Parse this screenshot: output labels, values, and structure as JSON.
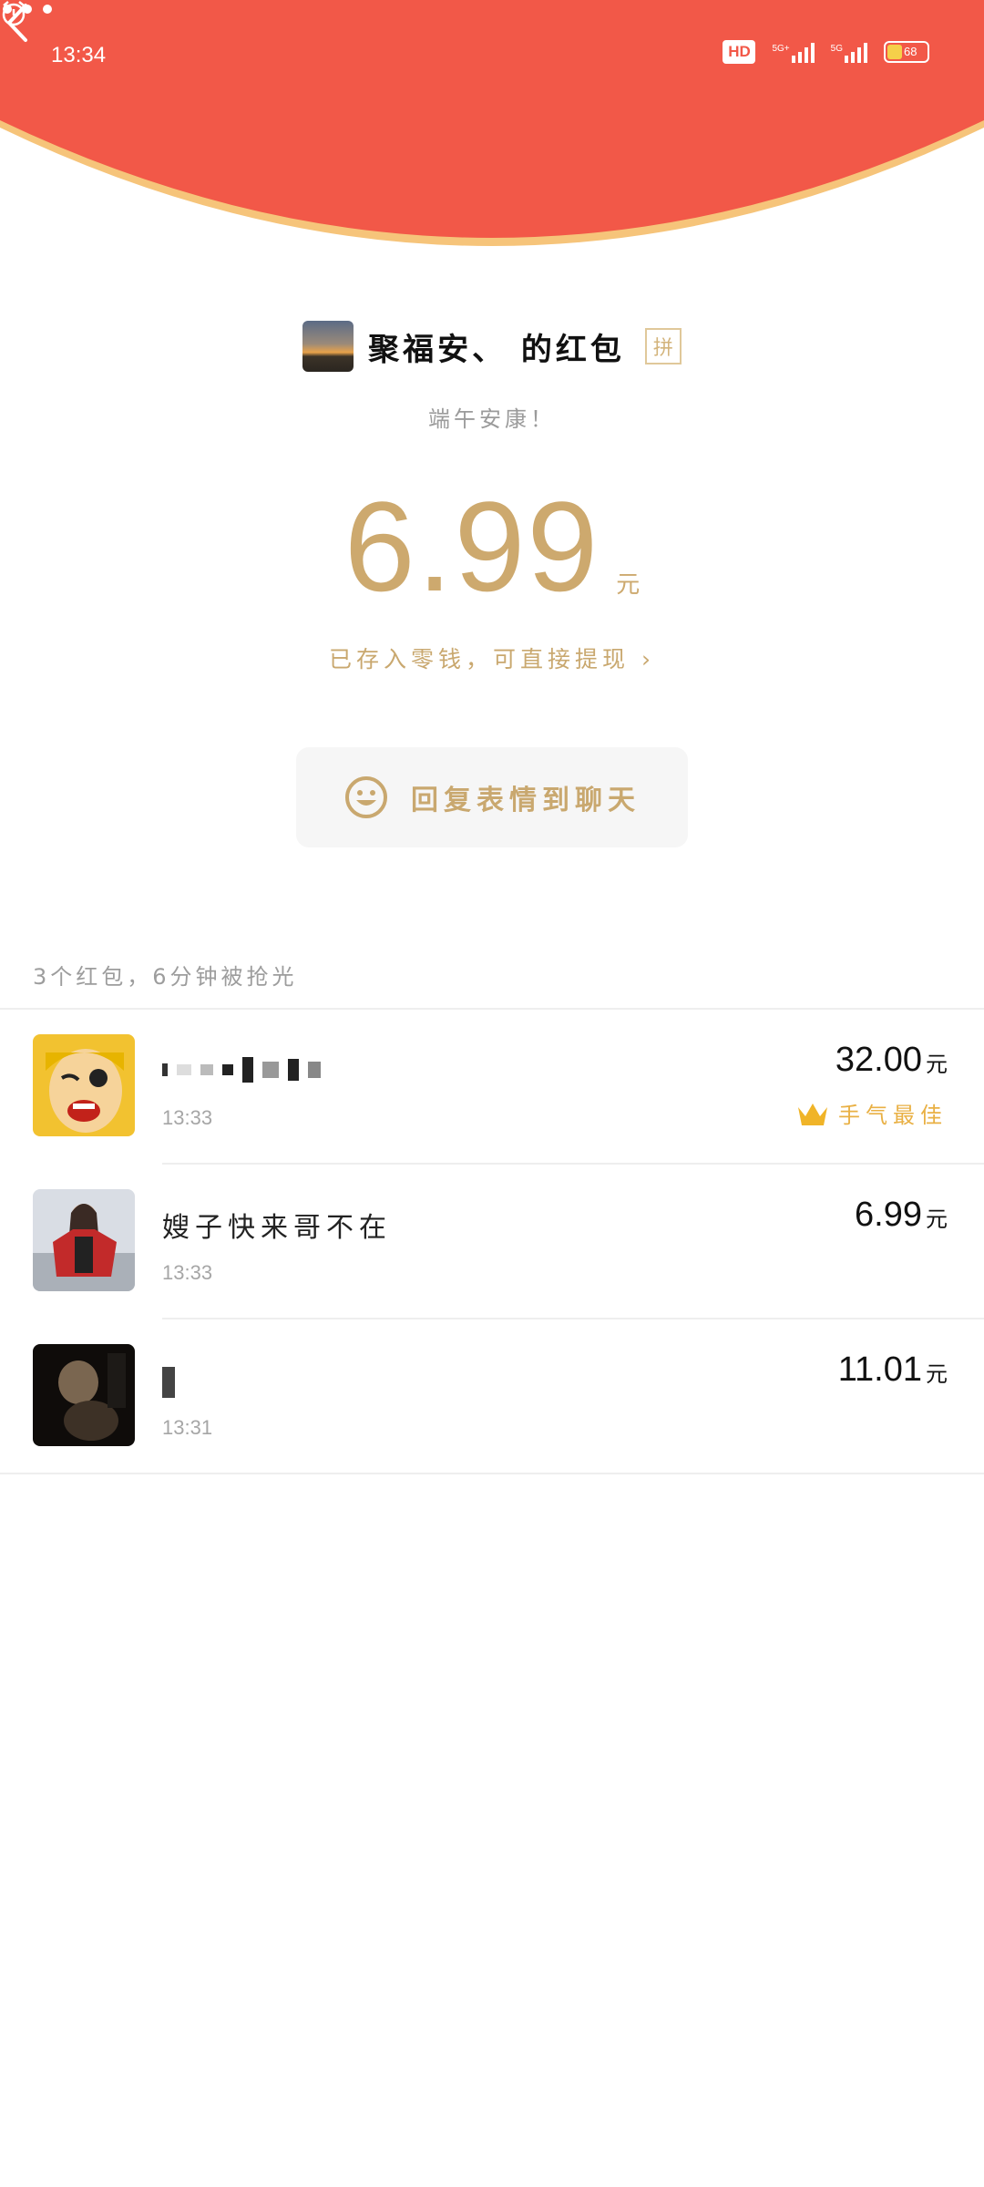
{
  "status_bar": {
    "time": "13:34",
    "hd_label": "HD",
    "sig1_label": "5G+",
    "sig2_label": "5G",
    "battery_level": "68"
  },
  "colors": {
    "header_red": "#f25848",
    "gold": "#cda96e",
    "best_luck": "#e9b044"
  },
  "header": {
    "back_icon": "chevron-left-icon",
    "more_icon": "more-dots-icon"
  },
  "packet": {
    "title": "聚福安、  的红包",
    "pin_badge": "拼",
    "greeting": "端午安康！",
    "amount": "6.99",
    "unit": "元",
    "saved_note": "已存入零钱，可直接提现 ›",
    "reply_button": "回复表情到聊天"
  },
  "summary": "3个红包，6分钟被抢光",
  "receivers": [
    {
      "name": "",
      "time": "13:33",
      "amount": "32.00",
      "unit": "元",
      "badge": "手气最佳"
    },
    {
      "name": "嫂子快来哥不在",
      "time": "13:33",
      "amount": "6.99",
      "unit": "元"
    },
    {
      "name": "",
      "time": "13:31",
      "amount": "11.01",
      "unit": "元"
    }
  ]
}
